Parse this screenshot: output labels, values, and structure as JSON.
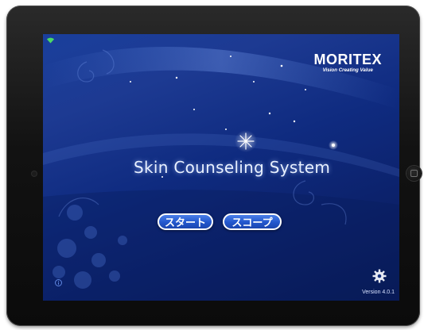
{
  "brand": {
    "logo": "MORITEX",
    "tagline": "Vision Creating Value"
  },
  "app": {
    "title": "Skin Counseling System",
    "version": "Version 4.0.1"
  },
  "buttons": {
    "start_label": "スタート",
    "scope_label": "スコープ"
  },
  "icons": {
    "status": "wifi-icon",
    "info": "info-icon",
    "settings": "gear-icon"
  },
  "colors": {
    "background": "#1a3a90",
    "button": "#2a5fd6",
    "text": "#ffffff"
  }
}
